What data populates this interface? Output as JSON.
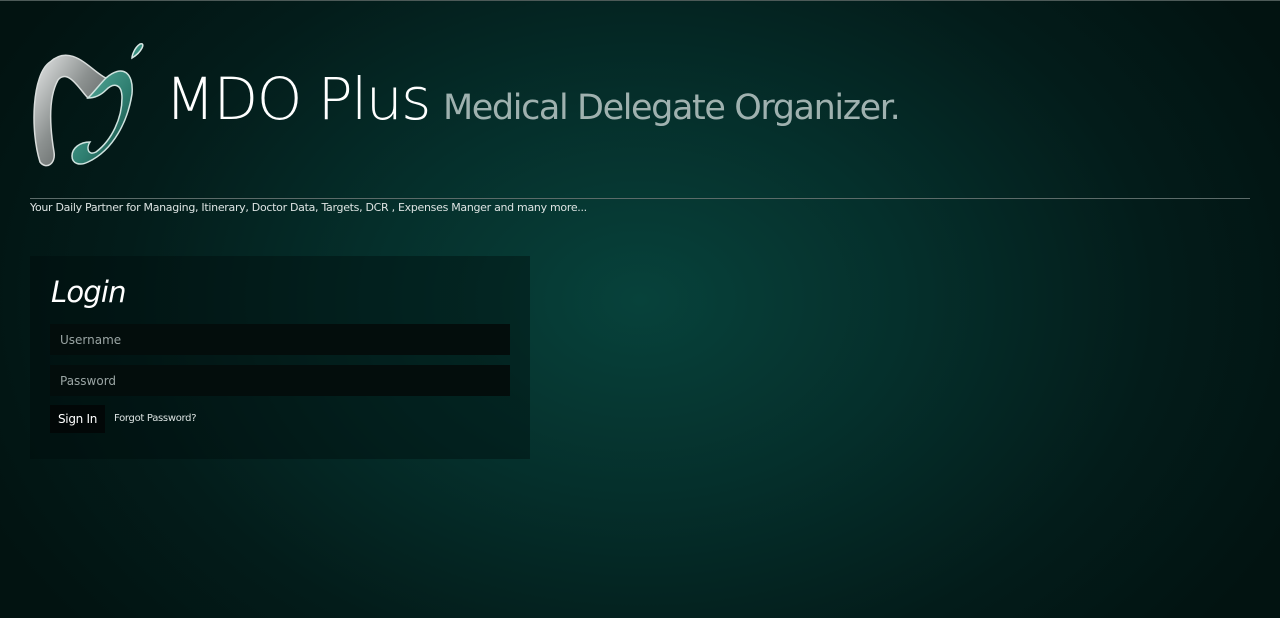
{
  "header": {
    "app_title": "MDO Plus",
    "app_subtitle": "Medical Delegate Organizer.",
    "logo_icon": "mdo-plus-logo",
    "tagline": "Your Daily Partner for Managing, Itinerary, Doctor Data, Targets, DCR , Expenses Manger and many more..."
  },
  "login": {
    "heading": "Login",
    "username": {
      "value": "",
      "placeholder": "Username"
    },
    "password": {
      "value": "",
      "placeholder": "Password"
    },
    "signin_label": "Sign In",
    "forgot_label": "Forgot Password?"
  },
  "colors": {
    "background_center": "#07423b",
    "background_edge": "#021311",
    "logo_teal": "#3a8f80",
    "logo_silver": "#b9bdbd",
    "subtitle": "#9fb1af"
  }
}
